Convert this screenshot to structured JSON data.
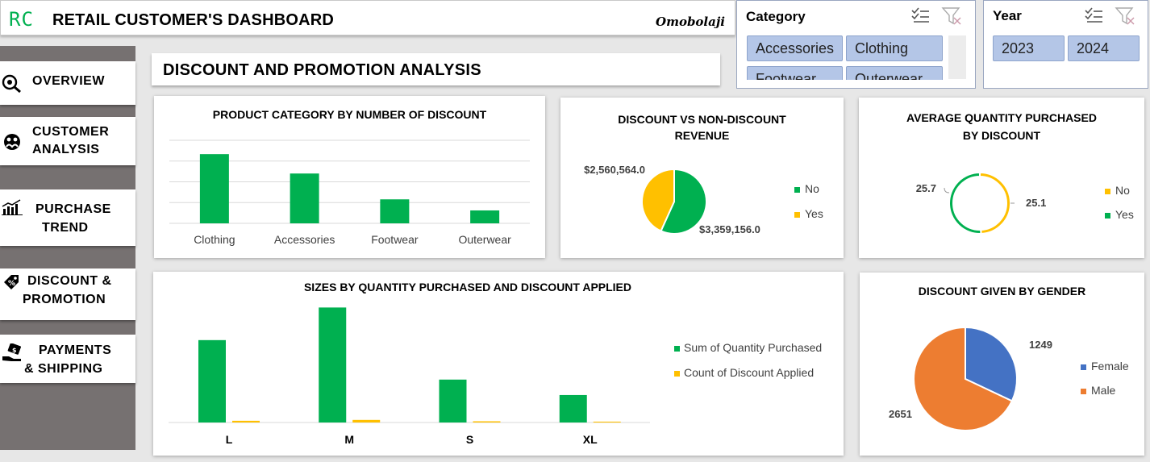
{
  "header": {
    "logo": "RC",
    "title": "RETAIL CUSTOMER'S DASHBOARD",
    "author": "Omobolaji"
  },
  "slicers": {
    "category": {
      "title": "Category",
      "items": [
        "Accessories",
        "Clothing",
        "Footwear",
        "Outerwear"
      ]
    },
    "year": {
      "title": "Year",
      "items": [
        "2023",
        "2024"
      ]
    }
  },
  "nav": {
    "overview": "OVERVIEW",
    "customer_1": "CUSTOMER",
    "customer_2": "ANALYSIS",
    "purchase_1": "PURCHASE",
    "purchase_2": "TREND",
    "discount_1": "DISCOUNT &",
    "discount_2": "PROMOTION",
    "payments_1": "PAYMENTS",
    "payments_2": "& SHIPPING"
  },
  "section": {
    "title": "DISCOUNT AND PROMOTION ANALYSIS"
  },
  "colors": {
    "green": "#00b050",
    "yellow": "#ffc000",
    "blue": "#4472c4",
    "orange": "#ed7d31",
    "sidebar": "#767171"
  },
  "chart_data": [
    {
      "type": "bar",
      "title": "PRODUCT CATEGORY BY NUMBER OF DISCOUNT",
      "categories": [
        "Clothing",
        "Accessories",
        "Footwear",
        "Outerwear"
      ],
      "values": [
        750,
        540,
        260,
        140
      ],
      "ylim": [
        0,
        900
      ],
      "grid": true,
      "series_color": "#00b050"
    },
    {
      "type": "pie",
      "title_line1": "DISCOUNT VS NON-DISCOUNT",
      "title_line2": "REVENUE",
      "slices": [
        {
          "name": "No",
          "value": 3359156.0,
          "label": "$3,359,156.0",
          "color": "#00b050"
        },
        {
          "name": "Yes",
          "value": 2560564.0,
          "label": "$2,560,564.0",
          "color": "#ffc000"
        }
      ],
      "legend": "right"
    },
    {
      "type": "pie",
      "variant": "doughnut",
      "title_line1": "AVERAGE QUANTITY PURCHASED",
      "title_line2": "BY DISCOUNT",
      "slices": [
        {
          "name": "No",
          "value": 25.1,
          "label": "25.1",
          "color": "#ffc000"
        },
        {
          "name": "Yes",
          "value": 25.7,
          "label": "25.7",
          "color": "#00b050"
        }
      ],
      "legend": "right"
    },
    {
      "type": "bar",
      "title": "SIZES BY QUANTITY PURCHASED AND DISCOUNT APPLIED",
      "categories": [
        "L",
        "M",
        "S",
        "XL"
      ],
      "series": [
        {
          "name": "Sum of Quantity Purchased",
          "values": [
            48000,
            67000,
            25000,
            16000
          ],
          "color": "#00b050"
        },
        {
          "name": "Count of Discount Applied",
          "values": [
            1000,
            1500,
            700,
            500
          ],
          "color": "#ffc000"
        }
      ],
      "ylim": [
        0,
        70000
      ],
      "legend": "right"
    },
    {
      "type": "pie",
      "title": "DISCOUNT GIVEN BY GENDER",
      "slices": [
        {
          "name": "Female",
          "value": 1249,
          "label": "1249",
          "color": "#4472c4"
        },
        {
          "name": "Male",
          "value": 2651,
          "label": "2651",
          "color": "#ed7d31"
        }
      ],
      "legend": "right"
    }
  ]
}
